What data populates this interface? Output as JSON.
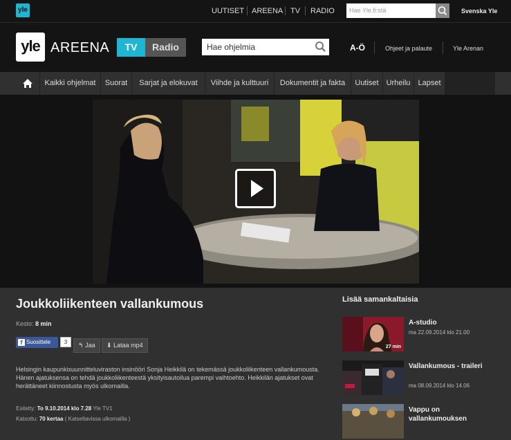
{
  "topbar": {
    "logo": "yle",
    "nav": [
      "UUTISET",
      "AREENA",
      "TV",
      "RADIO"
    ],
    "search_placeholder": "Hae Yle.fi:stä",
    "svenska": "Svenska Yle"
  },
  "header": {
    "logo": "yle",
    "brand": "AREENA",
    "tab_tv": "TV",
    "tab_radio": "Radio",
    "search_placeholder": "Hae ohjelmia",
    "az": "A-Ö",
    "links": [
      "Ohjeet ja palaute",
      "Yle Arenan"
    ]
  },
  "categories": [
    "Kaikki ohjelmat",
    "Suorat",
    "Sarjat ja elokuvat",
    "Viihde ja kulttuuri",
    "Dokumentit ja fakta",
    "Uutiset",
    "Urheilu",
    "Lapset"
  ],
  "program": {
    "title": "Joukkoliikenteen vallankumous",
    "duration_label": "Kesto:",
    "duration": "8 min",
    "fb_label": "Suosittele",
    "fb_count": "3",
    "share_label": "Jaa",
    "download_label": "Lataa mp4",
    "description": "Helsingin kaupunkisuunnitteluviraston insinööri Sonja Heikkilä on tekemässä joukkoliikenteen vallankumousta. Hänen ajatuksensa on tehdä joukkoliikenteestä yksityisautoilua parempi vaihtoehto. Heikkilän ajatukset ovat herättäneet kiinnostusta myös ulkomailla.",
    "aired_label": "Esitetty:",
    "aired": "To 9.10.2014 klo 7.28",
    "aired_channel": "Yle TV1",
    "views_label": "Katsottu:",
    "views": "70 kertaa",
    "views_note": "( Katseltavissa ulkomailla )"
  },
  "related": {
    "title": "Lisää samankaltaisia",
    "items": [
      {
        "name": "A-studio",
        "date": "ma 22.09.2014 klo 21.00",
        "duration": "27 min"
      },
      {
        "name": "Vallankumous - traileri",
        "date": "ma 08.09.2014 klo 14.06",
        "duration": ""
      },
      {
        "name": "Vappu on vallankumouksen",
        "date": "",
        "duration": ""
      }
    ]
  }
}
